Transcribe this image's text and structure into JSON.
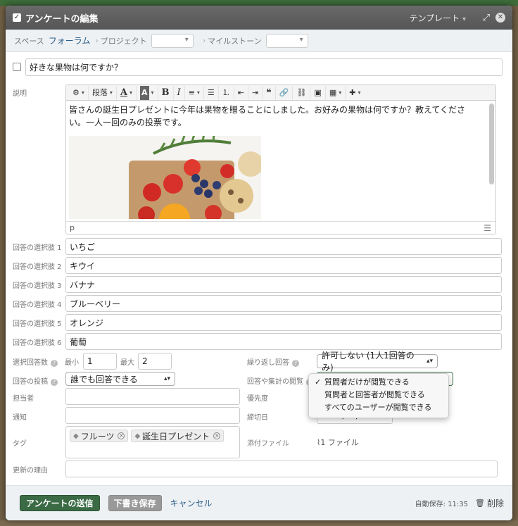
{
  "dialog": {
    "title": "アンケートの編集",
    "template_label": "テンプレート",
    "template_caret": "▾"
  },
  "breadcrumb": {
    "space_label": "スペース",
    "space_value": "フォーラム",
    "project_label": "プロジェクト",
    "milestone_label": "マイルストーン",
    "separator": "›"
  },
  "subject": {
    "value": "好きな果物は何ですか？"
  },
  "description": {
    "label": "説明",
    "toolbar": {
      "paragraph": "段落",
      "bold": "B",
      "italic": "I",
      "quote": "❝",
      "font_color": "A",
      "bg_color": "A"
    },
    "text": "皆さんの誕生日プレゼントに今年は果物を贈ることにしました。お好みの果物は何ですか？教えてください。一人一回のみの投票です。",
    "status_path": "p"
  },
  "choices": [
    {
      "label": "回答の選択肢 1",
      "value": "いちご"
    },
    {
      "label": "回答の選択肢 2",
      "value": "キウイ"
    },
    {
      "label": "回答の選択肢 3",
      "value": "バナナ"
    },
    {
      "label": "回答の選択肢 4",
      "value": "ブルーベリー"
    },
    {
      "label": "回答の選択肢 5",
      "value": "オレンジ"
    },
    {
      "label": "回答の選択肢 6",
      "value": "葡萄"
    }
  ],
  "settings": {
    "select_count_label": "選択回答数",
    "min_label": "最小",
    "min_value": "1",
    "max_label": "最大",
    "max_value": "2",
    "repeat_label": "繰り返し回答",
    "repeat_value": "許可しない (1人1回答のみ)",
    "post_label": "回答の投稿",
    "post_value": "誰でも回答できる",
    "view_label": "回答や集計の閲覧",
    "assignee_label": "担当者",
    "priority_label": "優先度",
    "notify_label": "通知",
    "deadline_label": "締切日",
    "deadline_value": "2017/05/05",
    "tags_label": "タグ",
    "tags": [
      "フルーツ",
      "誕生日プレゼント"
    ],
    "attachment_label": "添付ファイル",
    "attachment_value": "1 ファイル",
    "reason_label": "更新の理由",
    "help_mark": "?"
  },
  "view_dropdown": {
    "options": [
      {
        "label": "質問者だけが閲覧できる",
        "selected": true
      },
      {
        "label": "質問者と回答者が閲覧できる",
        "selected": false
      },
      {
        "label": "すべてのユーザーが閲覧できる",
        "selected": false
      }
    ],
    "check_mark": "✓"
  },
  "footer": {
    "submit_label": "アンケートの送信",
    "draft_label": "下書き保存",
    "cancel_label": "キャンセル",
    "autosave_text": "自動保存: 11:35",
    "delete_label": "削除"
  },
  "colors": {
    "primary": "#3a6b45",
    "link": "#2b5d8a",
    "titlebar": "#5a5a5a"
  },
  "icons": {
    "title_check": "checkbox-icon",
    "expand": "expand-icon",
    "close": "close-icon",
    "tag": "tag-icon",
    "paperclip": "paperclip-icon",
    "trash": "trash-icon"
  }
}
